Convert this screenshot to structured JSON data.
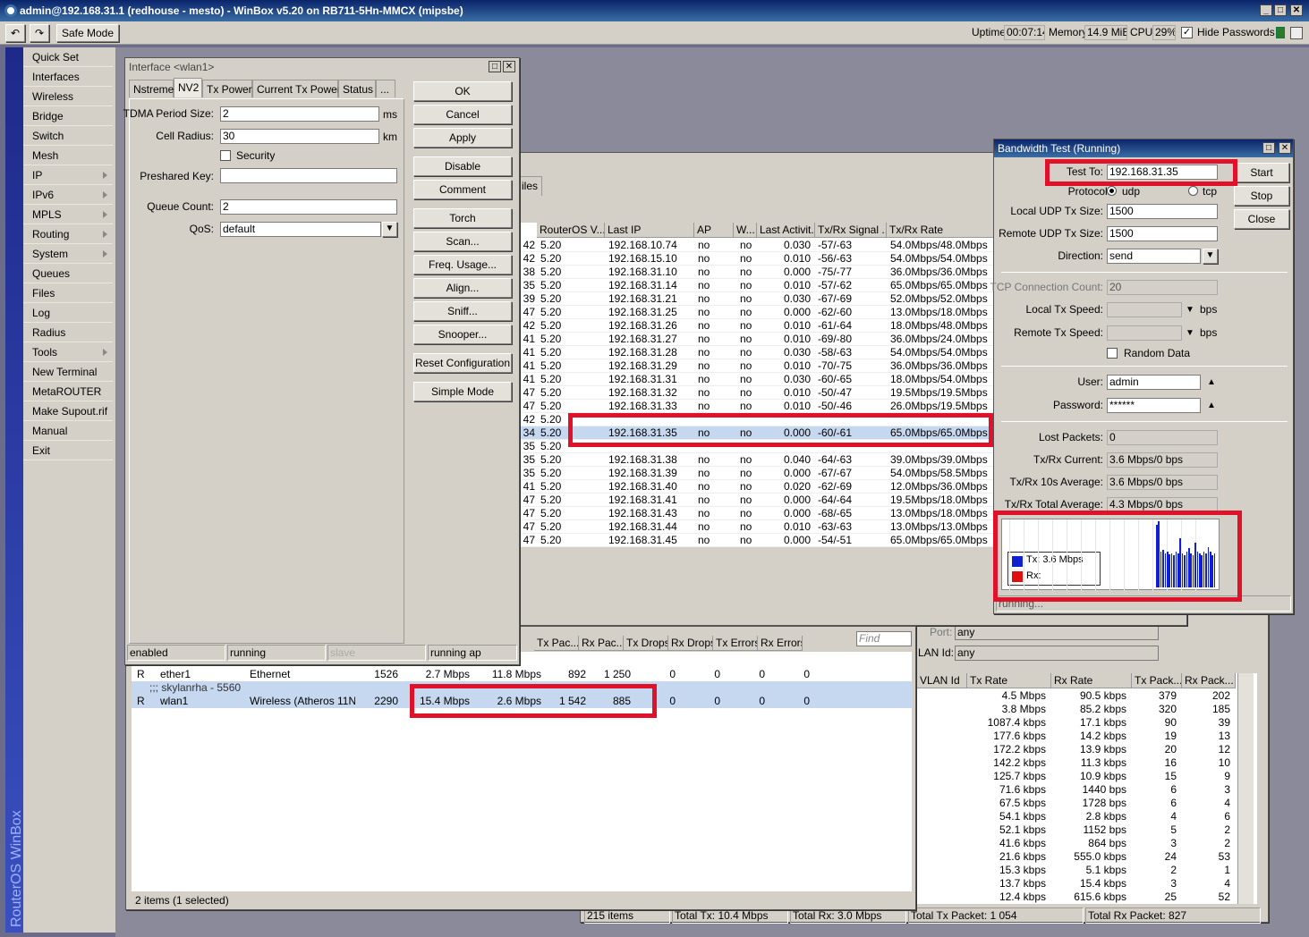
{
  "app": {
    "title": "admin@192.168.31.1 (redhouse - mesto) - WinBox v5.20 on RB711-5Hn-MMCX (mipsbe)",
    "safe_mode": "Safe Mode",
    "uptime_label": "Uptime:",
    "uptime": "00:07:14",
    "memory_label": "Memory:",
    "memory": "14.9 MiB",
    "cpu_label": "CPU:",
    "cpu": "29%",
    "hide_passwords": "Hide Passwords",
    "brand": "RouterOS WinBox"
  },
  "sidebar": [
    {
      "label": "Quick Set",
      "sub": false
    },
    {
      "label": "Interfaces",
      "sub": false
    },
    {
      "label": "Wireless",
      "sub": false
    },
    {
      "label": "Bridge",
      "sub": false
    },
    {
      "label": "Switch",
      "sub": false
    },
    {
      "label": "Mesh",
      "sub": false
    },
    {
      "label": "IP",
      "sub": true
    },
    {
      "label": "IPv6",
      "sub": true
    },
    {
      "label": "MPLS",
      "sub": true
    },
    {
      "label": "Routing",
      "sub": true
    },
    {
      "label": "System",
      "sub": true
    },
    {
      "label": "Queues",
      "sub": false
    },
    {
      "label": "Files",
      "sub": false
    },
    {
      "label": "Log",
      "sub": false
    },
    {
      "label": "Radius",
      "sub": false
    },
    {
      "label": "Tools",
      "sub": true
    },
    {
      "label": "New Terminal",
      "sub": false
    },
    {
      "label": "MetaROUTER",
      "sub": false
    },
    {
      "label": "Make Supout.rif",
      "sub": false
    },
    {
      "label": "Manual",
      "sub": false
    },
    {
      "label": "Exit",
      "sub": false
    }
  ],
  "iface": {
    "title": "Interface <wlan1>",
    "tabs": [
      "Nstreme",
      "NV2",
      "Tx Power",
      "Current Tx Power",
      "Status",
      "..."
    ],
    "tdma_label": "TDMA Period Size:",
    "tdma": "2",
    "tdma_unit": "ms",
    "cell_label": "Cell Radius:",
    "cell": "30",
    "cell_unit": "km",
    "security": "Security",
    "psk_label": "Preshared Key:",
    "psk": "",
    "queue_label": "Queue Count:",
    "queue": "2",
    "qos_label": "QoS:",
    "qos": "default",
    "buttons": [
      "OK",
      "Cancel",
      "Apply",
      "Disable",
      "Comment",
      "Torch",
      "Scan...",
      "Freq. Usage...",
      "Align...",
      "Sniff...",
      "Snooper...",
      "Reset Configuration",
      "Simple Mode"
    ],
    "status": [
      "enabled",
      "running",
      "slave",
      "running ap"
    ]
  },
  "reg": {
    "files_tab": "iles",
    "headers": [
      "RouterOS V...",
      "Last IP",
      "AP",
      "W...",
      "Last Activit...",
      "Tx/Rx Signal ...",
      "Tx/Rx Rate"
    ],
    "rows": [
      [
        "42",
        "5.20",
        "192.168.10.74",
        "no",
        "no",
        "0.030",
        "-57/-63",
        "54.0Mbps/48.0Mbps"
      ],
      [
        "42",
        "5.20",
        "192.168.15.10",
        "no",
        "no",
        "0.010",
        "-56/-63",
        "54.0Mbps/54.0Mbps"
      ],
      [
        "38",
        "5.20",
        "192.168.31.10",
        "no",
        "no",
        "0.000",
        "-75/-77",
        "36.0Mbps/36.0Mbps"
      ],
      [
        "35",
        "5.20",
        "192.168.31.14",
        "no",
        "no",
        "0.010",
        "-57/-62",
        "65.0Mbps/65.0Mbps"
      ],
      [
        "39",
        "5.20",
        "192.168.31.21",
        "no",
        "no",
        "0.030",
        "-67/-69",
        "52.0Mbps/52.0Mbps"
      ],
      [
        "47",
        "5.20",
        "192.168.31.25",
        "no",
        "no",
        "0.000",
        "-62/-60",
        "13.0Mbps/18.0Mbps"
      ],
      [
        "42",
        "5.20",
        "192.168.31.26",
        "no",
        "no",
        "0.010",
        "-61/-64",
        "18.0Mbps/48.0Mbps"
      ],
      [
        "41",
        "5.20",
        "192.168.31.27",
        "no",
        "no",
        "0.010",
        "-69/-80",
        "36.0Mbps/24.0Mbps"
      ],
      [
        "41",
        "5.20",
        "192.168.31.28",
        "no",
        "no",
        "0.030",
        "-58/-63",
        "54.0Mbps/54.0Mbps"
      ],
      [
        "41",
        "5.20",
        "192.168.31.29",
        "no",
        "no",
        "0.010",
        "-70/-75",
        "36.0Mbps/36.0Mbps"
      ],
      [
        "41",
        "5.20",
        "192.168.31.31",
        "no",
        "no",
        "0.030",
        "-60/-65",
        "18.0Mbps/54.0Mbps"
      ],
      [
        "47",
        "5.20",
        "192.168.31.32",
        "no",
        "no",
        "0.010",
        "-50/-47",
        "19.5Mbps/19.5Mbps"
      ],
      [
        "47",
        "5.20",
        "192.168.31.33",
        "no",
        "no",
        "0.010",
        "-50/-46",
        "26.0Mbps/19.5Mbps"
      ],
      [
        "42",
        "5.20",
        "",
        "",
        "",
        "",
        "",
        ""
      ],
      [
        "34",
        "5.20",
        "192.168.31.35",
        "no",
        "no",
        "0.000",
        "-60/-61",
        "65.0Mbps/65.0Mbps"
      ],
      [
        "35",
        "5.20",
        "",
        "",
        "",
        "",
        "",
        ""
      ],
      [
        "35",
        "5.20",
        "192.168.31.38",
        "no",
        "no",
        "0.040",
        "-64/-63",
        "39.0Mbps/39.0Mbps"
      ],
      [
        "35",
        "5.20",
        "192.168.31.39",
        "no",
        "no",
        "0.000",
        "-67/-67",
        "54.0Mbps/58.5Mbps"
      ],
      [
        "41",
        "5.20",
        "192.168.31.40",
        "no",
        "no",
        "0.020",
        "-62/-69",
        "12.0Mbps/36.0Mbps"
      ],
      [
        "47",
        "5.20",
        "192.168.31.41",
        "no",
        "no",
        "0.000",
        "-64/-64",
        "19.5Mbps/18.0Mbps"
      ],
      [
        "47",
        "5.20",
        "192.168.31.43",
        "no",
        "no",
        "0.000",
        "-68/-65",
        "13.0Mbps/18.0Mbps"
      ],
      [
        "47",
        "5.20",
        "192.168.31.44",
        "no",
        "no",
        "0.010",
        "-63/-63",
        "13.0Mbps/13.0Mbps"
      ],
      [
        "47",
        "5.20",
        "192.168.31.45",
        "no",
        "no",
        "0.000",
        "-54/-51",
        "65.0Mbps/65.0Mbps"
      ]
    ]
  },
  "bw": {
    "title": "Bandwidth Test (Running)",
    "test_to_label": "Test To:",
    "test_to": "192.168.31.35",
    "protocol_label": "Protocol:",
    "udp": "udp",
    "tcp": "tcp",
    "local_udp_label": "Local UDP Tx Size:",
    "local_udp": "1500",
    "remote_udp_label": "Remote UDP Tx Size:",
    "remote_udp": "1500",
    "direction_label": "Direction:",
    "direction": "send",
    "tcp_count_label": "TCP Connection Count:",
    "tcp_count": "20",
    "local_speed_label": "Local Tx Speed:",
    "remote_speed_label": "Remote Tx Speed:",
    "bps": "bps",
    "random": "Random Data",
    "user_label": "User:",
    "user": "admin",
    "pass_label": "Password:",
    "pass": "******",
    "lost_label": "Lost Packets:",
    "lost": "0",
    "cur_label": "Tx/Rx Current:",
    "cur": "3.6 Mbps/0 bps",
    "avg10_label": "Tx/Rx 10s Average:",
    "avg10": "3.6 Mbps/0 bps",
    "total_label": "Tx/Rx Total Average:",
    "total": "4.3 Mbps/0 bps",
    "legend_tx": "Tx:  3.6 Mbps",
    "legend_rx": "Rx:",
    "status": "running...",
    "buttons": [
      "Start",
      "Stop",
      "Close"
    ],
    "colors": {
      "tx": "#1020d0",
      "rx": "#e01010"
    }
  },
  "ifaces": {
    "find": "Find",
    "headers": [
      "Tx Pac...",
      "Rx Pac...",
      "Tx Drops",
      "Rx Drops",
      "Tx Errors",
      "Rx Errors"
    ],
    "rows": [
      {
        "flag": "R",
        "name": "ether1",
        "type": "Ethernet",
        "mtu": "1526",
        "tx": "2.7 Mbps",
        "rx": "11.8 Mbps",
        "txp": "892",
        "rxp": "1 250",
        "txd": "0",
        "rxd": "0",
        "txe": "0",
        "rxe": "0"
      },
      {
        "flag": "R",
        "name": "wlan1",
        "type": "Wireless (Atheros 11N)",
        "mtu": "2290",
        "tx": "15.4 Mbps",
        "rx": "2.6 Mbps",
        "txp": "1 542",
        "rxp": "885",
        "txd": "0",
        "rxd": "0",
        "txe": "0",
        "rxe": "0"
      }
    ],
    "comment": ";;; skylanrha - 5560",
    "footer": "2 items (1 selected)"
  },
  "torch": {
    "port_label": "Port:",
    "port": "any",
    "vlan_label": "LAN Id:",
    "vlan": "any",
    "headers": [
      "VLAN Id",
      "Tx Rate",
      "Rx Rate",
      "Tx Pack...",
      "Rx Pack..."
    ],
    "rows": [
      [
        "4.5 Mbps",
        "90.5 kbps",
        "379",
        "202"
      ],
      [
        "3.8 Mbps",
        "85.2 kbps",
        "320",
        "185"
      ],
      [
        "1087.4 kbps",
        "17.1 kbps",
        "90",
        "39"
      ],
      [
        "177.6 kbps",
        "14.2 kbps",
        "19",
        "13"
      ],
      [
        "172.2 kbps",
        "13.9 kbps",
        "20",
        "12"
      ],
      [
        "142.2 kbps",
        "11.3 kbps",
        "16",
        "10"
      ],
      [
        "125.7 kbps",
        "10.9 kbps",
        "15",
        "9"
      ],
      [
        "71.6 kbps",
        "1440 bps",
        "6",
        "3"
      ],
      [
        "67.5 kbps",
        "1728 bps",
        "6",
        "4"
      ],
      [
        "54.1 kbps",
        "2.8 kbps",
        "4",
        "6"
      ],
      [
        "52.1 kbps",
        "1152 bps",
        "5",
        "2"
      ],
      [
        "41.6 kbps",
        "864 bps",
        "3",
        "2"
      ],
      [
        "21.6 kbps",
        "555.0 kbps",
        "24",
        "53"
      ],
      [
        "15.3 kbps",
        "5.1 kbps",
        "2",
        "1"
      ],
      [
        "13.7 kbps",
        "15.4 kbps",
        "3",
        "4"
      ],
      [
        "12.4 kbps",
        "615.6 kbps",
        "25",
        "52"
      ]
    ],
    "footer_items": "215 items",
    "footer_tx": "Total Tx: 10.4 Mbps",
    "footer_rx": "Total Rx: 3.0 Mbps",
    "footer_txp": "Total Tx Packet: 1 054",
    "footer_rxp": "Total Rx Packet: 827"
  }
}
